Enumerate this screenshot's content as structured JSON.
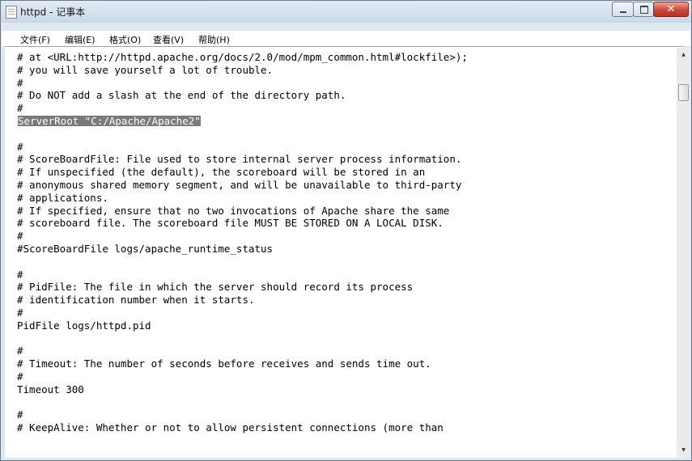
{
  "window": {
    "title": "httpd - 记事本"
  },
  "menu": [
    "文件(F)",
    "编辑(E)",
    "格式(O)",
    "查看(V)",
    "帮助(H)"
  ],
  "controls": {
    "close_glyph": "✕"
  },
  "scrollbar": {
    "up_glyph": "▲",
    "down_glyph": "▼"
  },
  "editor": {
    "lines": [
      "# at <URL:http://httpd.apache.org/docs/2.0/mod/mpm_common.html#lockfile>);",
      "# you will save yourself a lot of trouble.",
      "#",
      "# Do NOT add a slash at the end of the directory path.",
      "#",
      "ServerRoot \"C:/Apache/Apache2\"",
      "",
      "#",
      "# ScoreBoardFile: File used to store internal server process information.",
      "# If unspecified (the default), the scoreboard will be stored in an",
      "# anonymous shared memory segment, and will be unavailable to third-party",
      "# applications.",
      "# If specified, ensure that no two invocations of Apache share the same",
      "# scoreboard file. The scoreboard file MUST BE STORED ON A LOCAL DISK.",
      "#",
      "#ScoreBoardFile logs/apache_runtime_status",
      "",
      "#",
      "# PidFile: The file in which the server should record its process",
      "# identification number when it starts.",
      "#",
      "PidFile logs/httpd.pid",
      "",
      "#",
      "# Timeout: The number of seconds before receives and sends time out.",
      "#",
      "Timeout 300",
      "",
      "#",
      "# KeepAlive: Whether or not to allow persistent connections (more than"
    ],
    "selected_line": 5
  }
}
